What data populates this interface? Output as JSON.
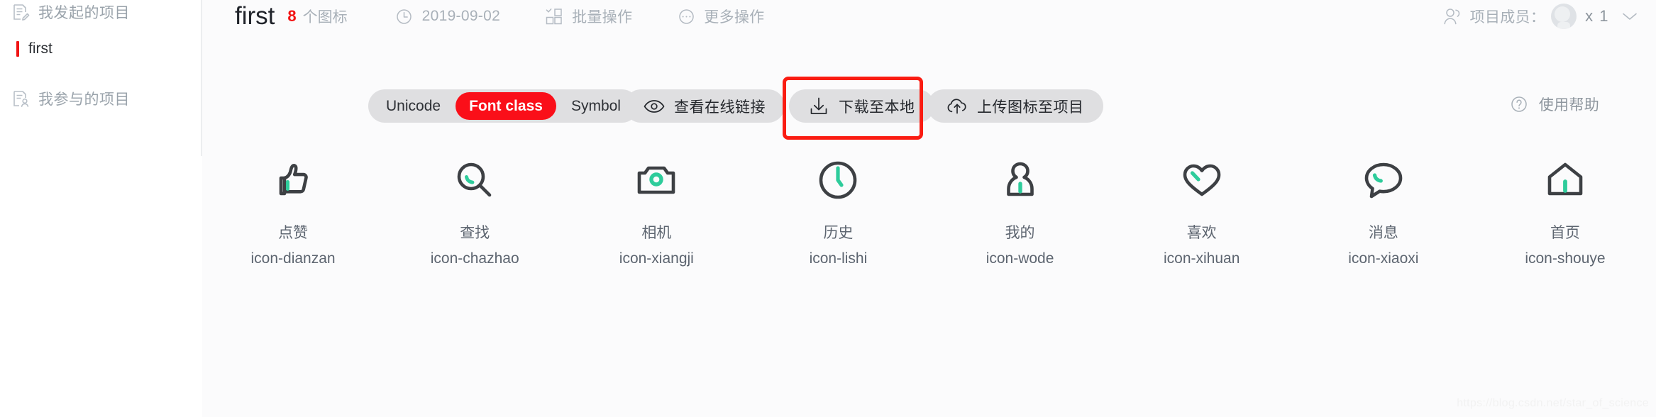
{
  "sidebar": {
    "groups": [
      {
        "icon": "doc-edit-icon",
        "label": "我发起的项目"
      },
      {
        "icon": "doc-user-icon",
        "label": "我参与的项目"
      }
    ],
    "active_project": "first"
  },
  "header": {
    "project_title": "first",
    "icon_count": "8",
    "icon_count_unit": "个图标",
    "date_icon": "clock-icon",
    "date": "2019-09-02",
    "batch_icon": "batch-select-icon",
    "batch_label": "批量操作",
    "more_icon": "ellipsis-circle-icon",
    "more_label": "更多操作",
    "members_icon": "user-group-icon",
    "members_label": "项目成员：",
    "members_count": "x 1",
    "caret_icon": "chevron-down-icon"
  },
  "toolbar": {
    "segments": [
      {
        "label": "Unicode",
        "active": false
      },
      {
        "label": "Font class",
        "active": true
      },
      {
        "label": "Symbol",
        "active": false
      }
    ],
    "active_segment_color": "#fa0f19",
    "buttons": [
      {
        "icon": "eye-icon",
        "label": "查看在线链接"
      },
      {
        "icon": "download-icon",
        "label": "下载至本地",
        "highlighted": true
      },
      {
        "icon": "cloud-upload-icon",
        "label": "上传图标至项目"
      }
    ],
    "highlight_color": "#fa1c12",
    "help_icon": "question-circle-icon",
    "help_label": "使用帮助"
  },
  "icons": {
    "stroke_color": "#3d4044",
    "accent_color": "#2ecc9b",
    "items": [
      {
        "glyph": "thumbs-up-icon",
        "name": "点赞",
        "class": "icon-dianzan"
      },
      {
        "glyph": "search-icon",
        "name": "查找",
        "class": "icon-chazhao"
      },
      {
        "glyph": "camera-icon",
        "name": "相机",
        "class": "icon-xiangji"
      },
      {
        "glyph": "clock-icon",
        "name": "历史",
        "class": "icon-lishi"
      },
      {
        "glyph": "user-icon",
        "name": "我的",
        "class": "icon-wode"
      },
      {
        "glyph": "heart-icon",
        "name": "喜欢",
        "class": "icon-xihuan"
      },
      {
        "glyph": "message-icon",
        "name": "消息",
        "class": "icon-xiaoxi"
      },
      {
        "glyph": "home-icon",
        "name": "首页",
        "class": "icon-shouye"
      }
    ]
  },
  "watermark": "https://blog.csdn.net/star_of_science"
}
